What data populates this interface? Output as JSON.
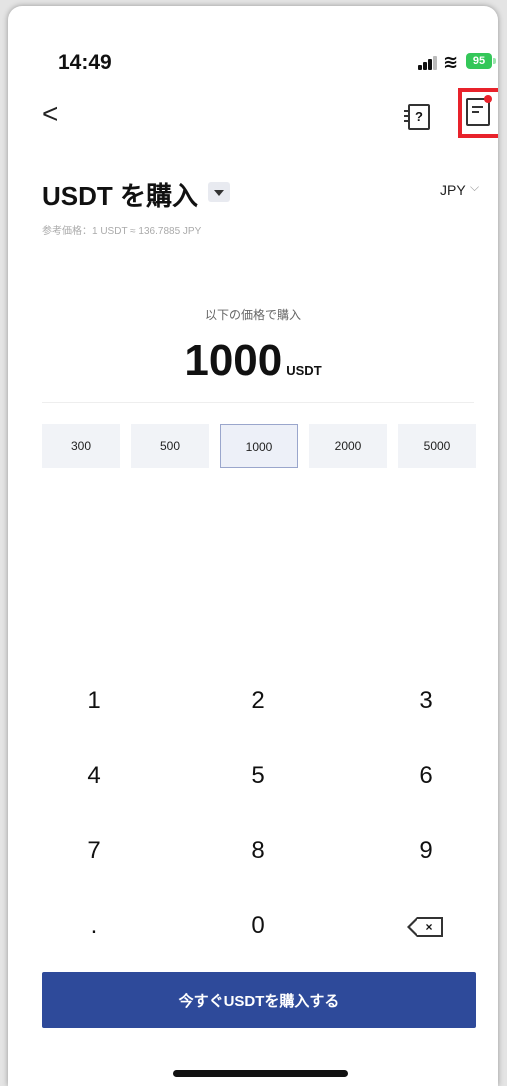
{
  "status_bar": {
    "time": "14:49",
    "battery": "95"
  },
  "nav": {
    "back": "<",
    "help_icon_glyph": "?"
  },
  "header": {
    "title": "USDT を購入",
    "currency": "JPY",
    "currency_chevron": "⌵",
    "reference_price": "参考価格：1 USDT ≈ 136.7885 JPY"
  },
  "amount": {
    "label": "以下の価格で購入",
    "value": "1000",
    "unit": "USDT"
  },
  "presets": [
    "300",
    "500",
    "1000",
    "2000",
    "5000"
  ],
  "selected_preset": "1000",
  "keypad": {
    "k1": "1",
    "k2": "2",
    "k3": "3",
    "k4": "4",
    "k5": "5",
    "k6": "6",
    "k7": "7",
    "k8": "8",
    "k9": "9",
    "kdot": ".",
    "k0": "0",
    "backspace_glyph": "×"
  },
  "buy_button": "今すぐUSDTを購入する",
  "colors": {
    "primary": "#2e4a9a",
    "highlight": "#e8222b",
    "battery": "#34c759"
  }
}
